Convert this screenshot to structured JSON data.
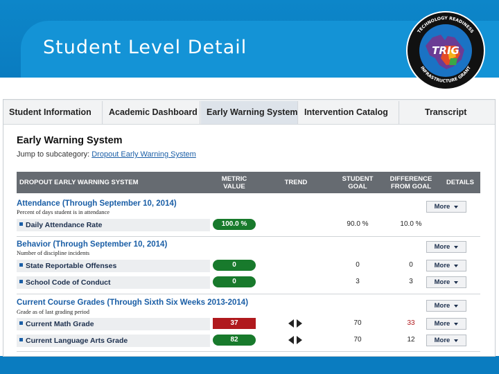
{
  "slide": {
    "title": "Student Level Detail",
    "logo": {
      "icon": "trig-michigan-seal",
      "center_text": "TRIG",
      "ring_text": "TECHNOLOGY READINESS INFRASTRUCTURE GRANT"
    }
  },
  "tabs": [
    {
      "label": "Student Information",
      "active": false
    },
    {
      "label": "Academic Dashboard",
      "active": false
    },
    {
      "label": "Early Warning System",
      "active": true
    },
    {
      "label": "Intervention Catalog",
      "active": false
    },
    {
      "label": "Transcript",
      "active": false
    }
  ],
  "page": {
    "title": "Early Warning System",
    "jump_prefix": "Jump to subcategory:",
    "jump_link": "Dropout Early Warning System"
  },
  "table_headers": {
    "system": "DROPOUT EARLY WARNING SYSTEM",
    "metric_value": "METRIC VALUE",
    "trend": "TREND",
    "student_goal": "STUDENT GOAL",
    "difference": "DIFFERENCE FROM GOAL",
    "details": "DETAILS"
  },
  "more_label": "More",
  "categories": [
    {
      "title": "Attendance (Through September 10, 2014)",
      "subtitle": "Percent of days student is in attendance",
      "rows": [
        {
          "label": "Daily Attendance Rate",
          "metric": "100.0 %",
          "status": "green",
          "trend": "",
          "goal": "90.0 %",
          "diff": "10.0 %",
          "diff_negative": false
        }
      ]
    },
    {
      "title": "Behavior (Through September 10, 2014)",
      "subtitle": "Number of discipline incidents",
      "rows": [
        {
          "label": "State Reportable Offenses",
          "metric": "0",
          "status": "green",
          "trend": "",
          "goal": "0",
          "diff": "0",
          "diff_negative": false
        },
        {
          "label": "School Code of Conduct",
          "metric": "0",
          "status": "green",
          "trend": "",
          "goal": "3",
          "diff": "3",
          "diff_negative": false
        }
      ]
    },
    {
      "title": "Current Course Grades (Through Sixth Six Weeks 2013-2014)",
      "subtitle": "Grade as of last grading period",
      "rows": [
        {
          "label": "Current Math Grade",
          "metric": "37",
          "status": "red",
          "trend": "left-right-arrows-icon",
          "goal": "70",
          "diff": "33",
          "diff_negative": true
        },
        {
          "label": "Current Language Arts Grade",
          "metric": "82",
          "status": "green",
          "trend": "left-right-arrows-icon",
          "goal": "70",
          "diff": "12",
          "diff_negative": false
        }
      ]
    }
  ],
  "colors": {
    "header_blue": "#0d86c9",
    "link_blue": "#1a5ea6",
    "green": "#187a2c",
    "red": "#b0191d"
  }
}
